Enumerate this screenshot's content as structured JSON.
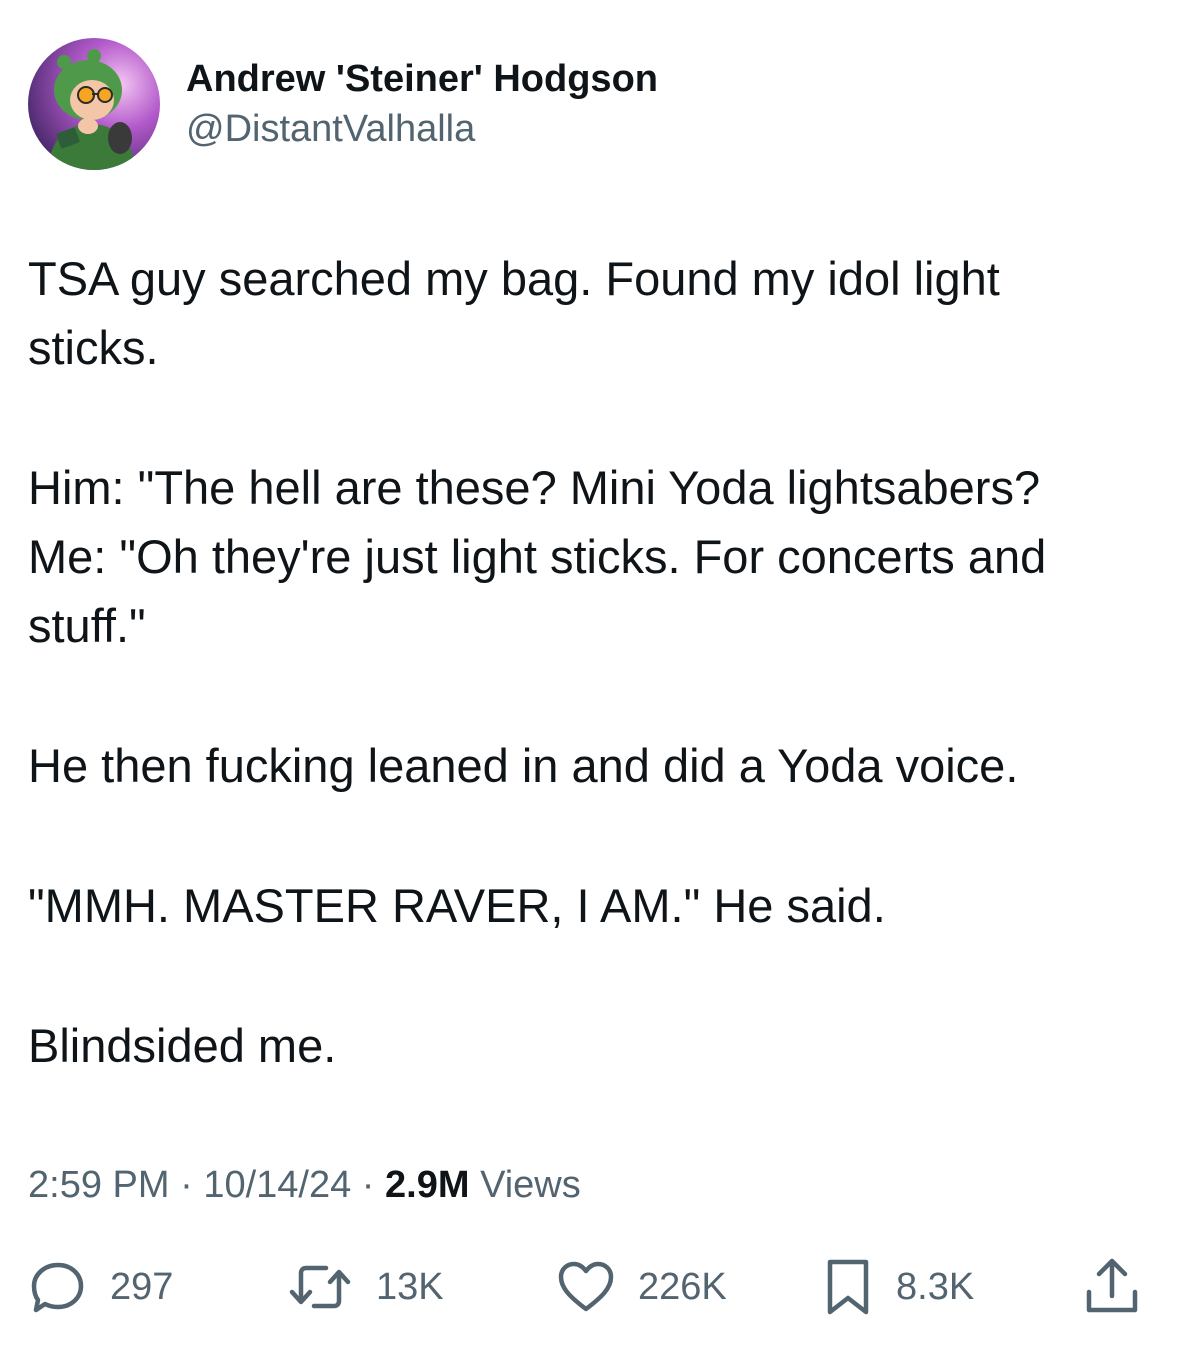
{
  "author": {
    "display_name": "Andrew 'Steiner' Hodgson",
    "handle": "@DistantValhalla"
  },
  "tweet": {
    "paragraphs": [
      "TSA guy searched my bag. Found my idol light\nsticks.",
      "Him: \"The hell are these? Mini Yoda lightsabers?\nMe: \"Oh they're just light sticks. For concerts and\nstuff.\"",
      "He then fucking leaned in and did a Yoda voice.",
      "\"MMH. MASTER RAVER, I AM.\" He said.",
      "Blindsided me."
    ]
  },
  "meta": {
    "time": "2:59 PM",
    "separator": "·",
    "date": "10/14/24",
    "views_count": "2.9M",
    "views_label": "Views"
  },
  "actions": {
    "replies": "297",
    "reposts": "13K",
    "likes": "226K",
    "bookmarks": "8.3K"
  },
  "colors": {
    "text_primary": "#0f1419",
    "text_secondary": "#536471",
    "background": "#ffffff"
  },
  "icons": {
    "reply": "reply-icon",
    "repost": "repost-icon",
    "like": "heart-icon",
    "bookmark": "bookmark-icon",
    "share": "share-icon"
  }
}
